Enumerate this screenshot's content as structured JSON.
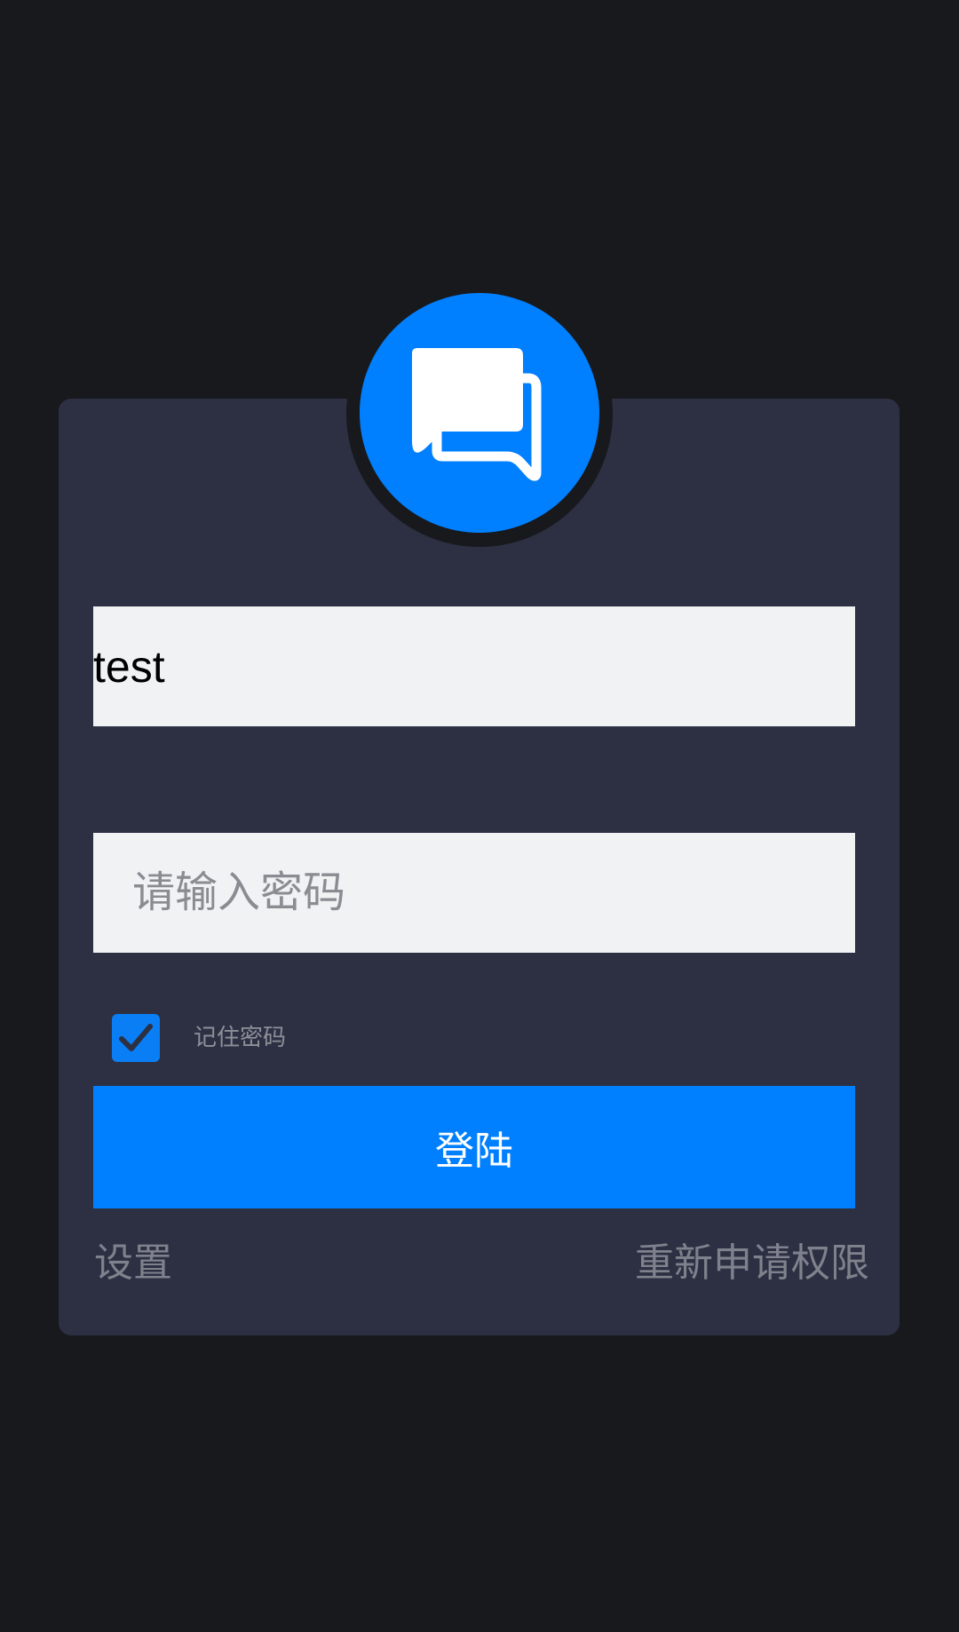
{
  "login": {
    "username_value": "test",
    "password_placeholder": "请输入密码",
    "remember_label": "记住密码",
    "remember_checked": true,
    "login_button": "登陆",
    "settings_link": "设置",
    "reapply_link": "重新申请权限"
  },
  "icons": {
    "logo": "chat-bubbles-icon",
    "checkbox": "checkmark-icon"
  },
  "colors": {
    "background": "#18191d",
    "card": "#2d3043",
    "accent": "#0080ff",
    "input_bg": "#f1f2f4",
    "muted_text": "#7f828c"
  }
}
